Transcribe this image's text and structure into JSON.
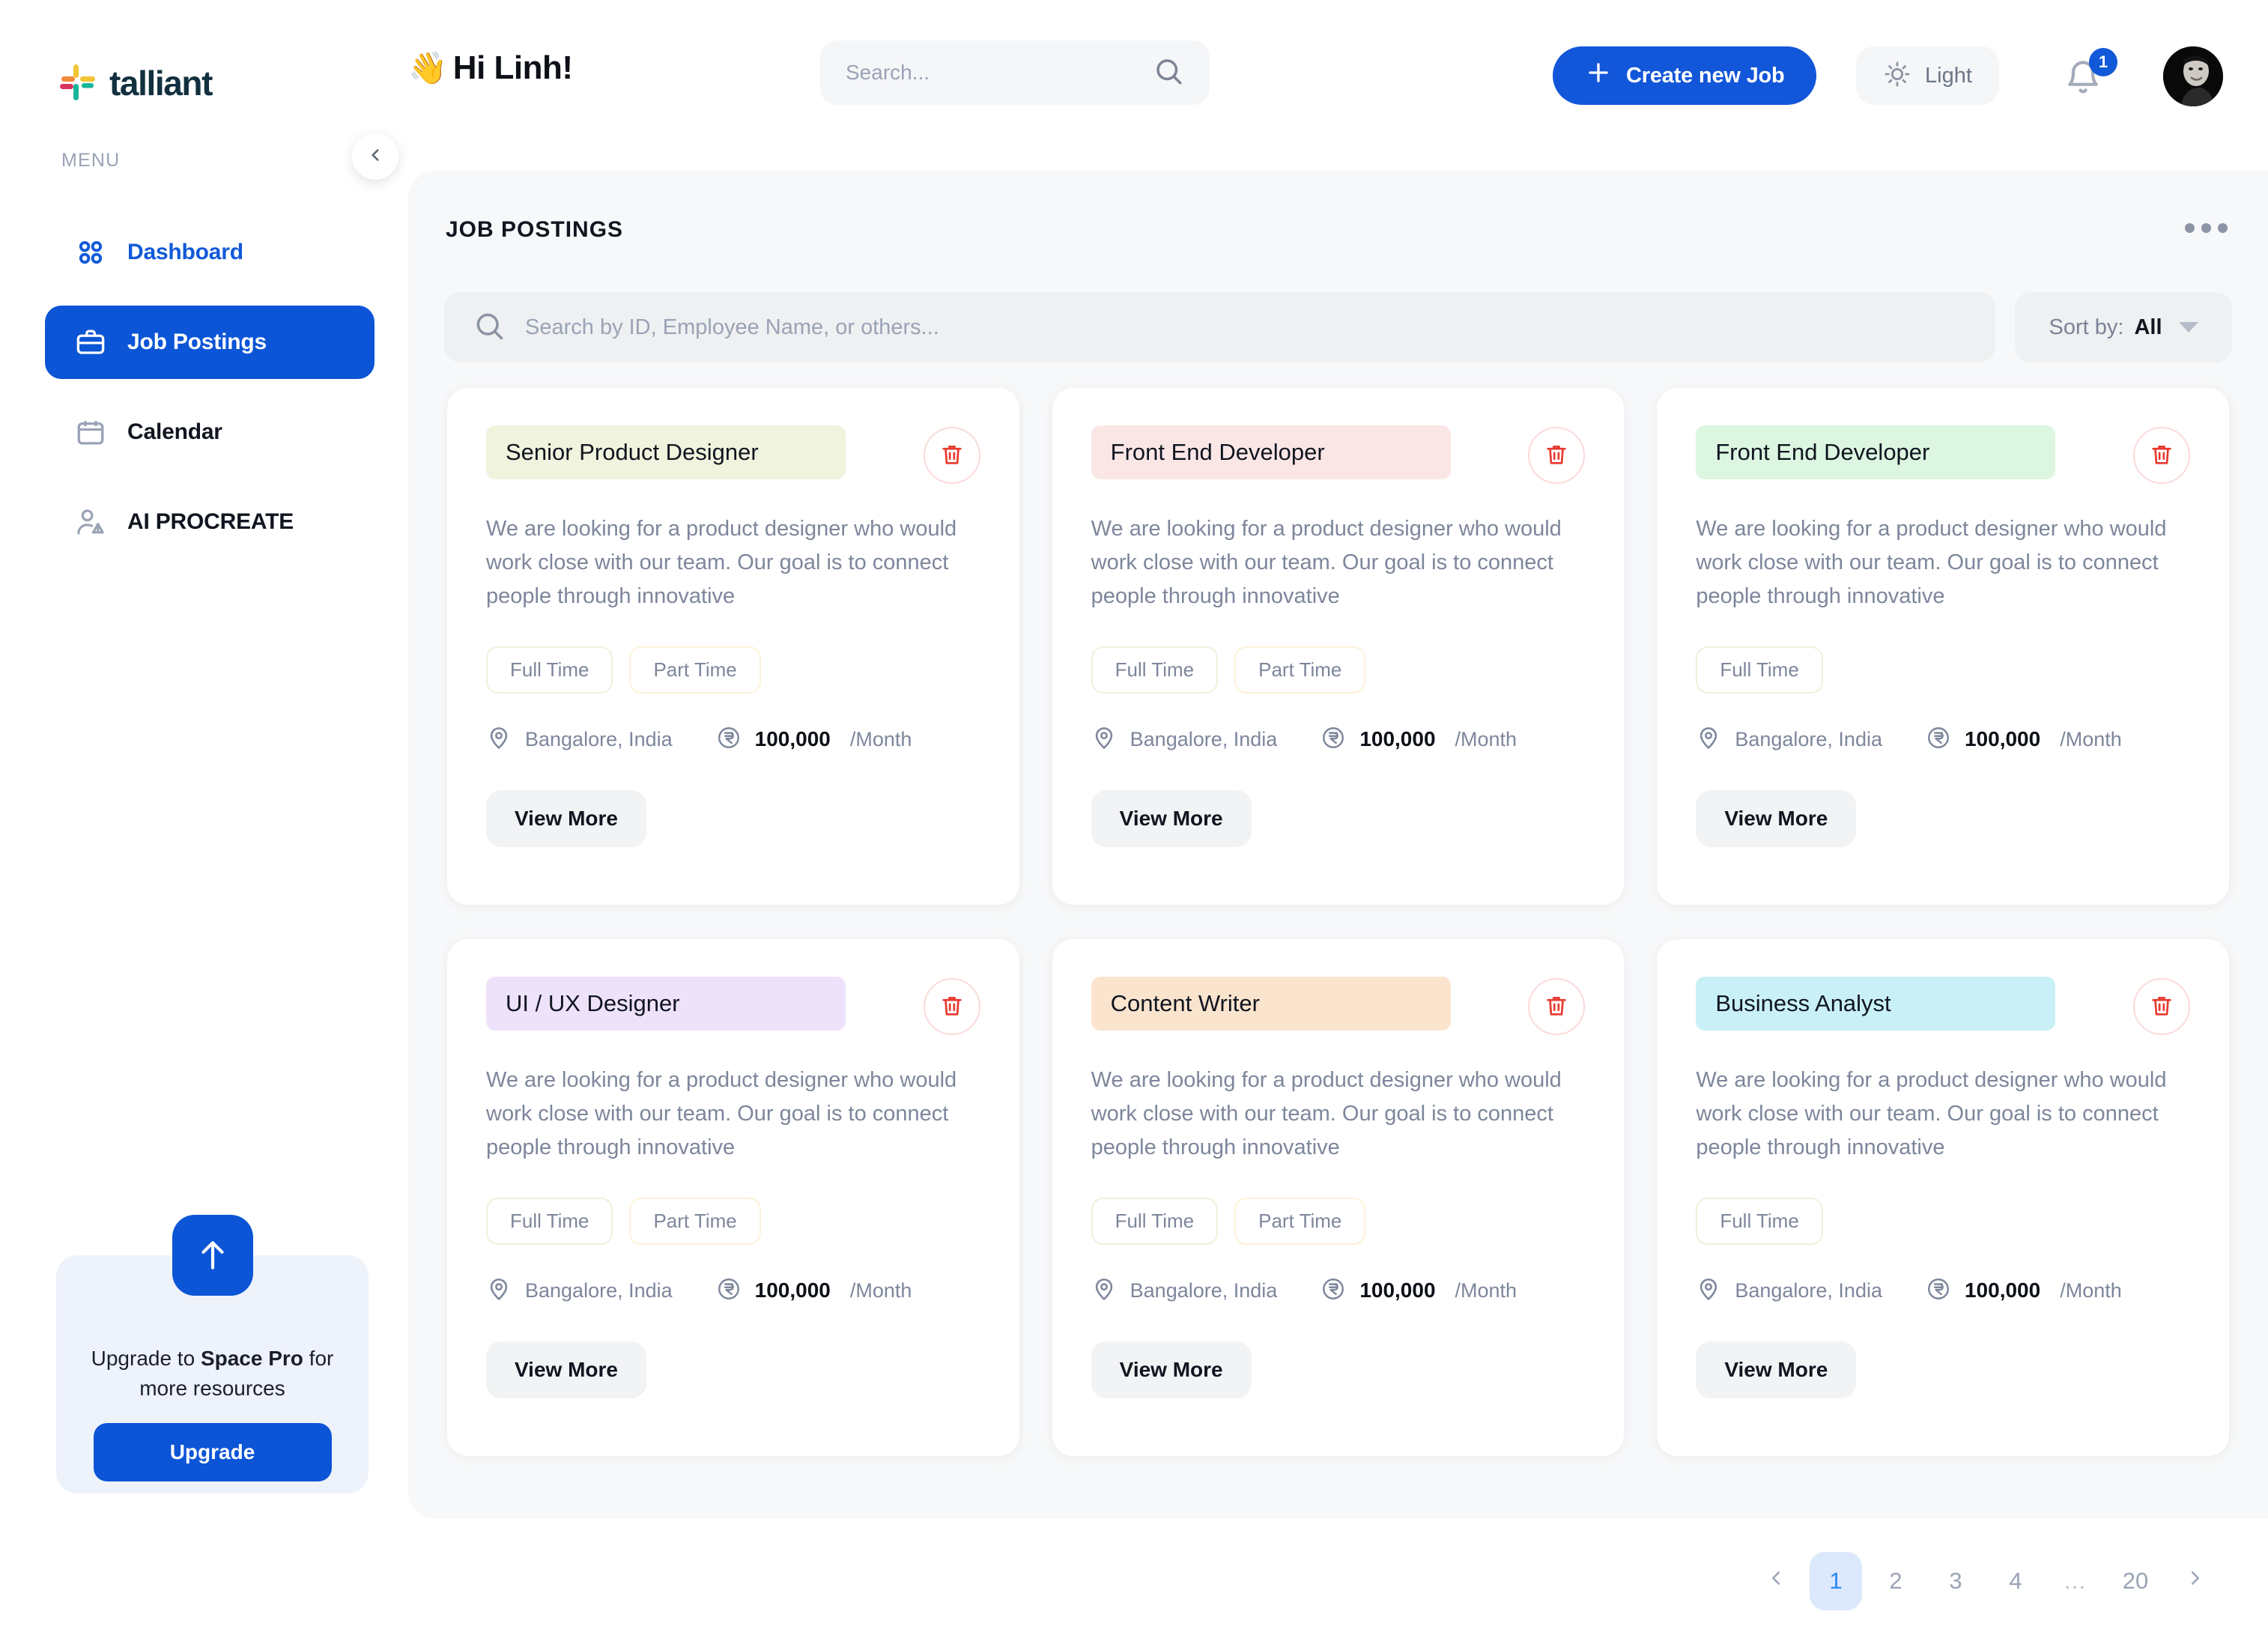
{
  "brand": {
    "name": "talliant",
    "logo_icon": "talliant-cross-logo"
  },
  "sidebar": {
    "menu_label": "MENU",
    "collapse_icon": "chevron-left-icon",
    "items": [
      {
        "label": "Dashboard",
        "icon": "grid-dots-icon",
        "state": "highlighted"
      },
      {
        "label": "Job Postings",
        "icon": "briefcase-icon",
        "state": "active"
      },
      {
        "label": "Calendar",
        "icon": "calendar-icon",
        "state": "default"
      },
      {
        "label": "AI PROCREATE",
        "icon": "user-alert-icon",
        "state": "default"
      }
    ],
    "upgrade": {
      "icon": "arrow-up-icon",
      "text_before": "Upgrade to ",
      "text_bold": "Space Pro",
      "text_after": " for more resources",
      "button_label": "Upgrade"
    }
  },
  "topbar": {
    "greeting_emoji": "👋",
    "greeting": "Hi Linh!",
    "search": {
      "value": "",
      "placeholder": "Search...",
      "icon": "search-icon"
    },
    "create_button": {
      "label": "Create new Job",
      "icon": "plus-icon"
    },
    "theme_toggle": {
      "label": "Light",
      "icon": "sun-icon"
    },
    "notifications": {
      "count": "1",
      "icon": "bell-icon"
    },
    "avatar": {
      "icon": "user-avatar"
    }
  },
  "panel": {
    "title": "JOB POSTINGS",
    "more_icon": "ellipsis-icon",
    "search": {
      "value": "",
      "placeholder": "Search by ID, Employee Name, or others...",
      "icon": "search-icon"
    },
    "sort": {
      "label": "Sort by:",
      "value": "All",
      "icon": "chevron-down-icon"
    }
  },
  "colors": {
    "brand_blue": "#0b55d6",
    "accent_blue": "#1159d8",
    "panel_bg": "#f7f8f9",
    "delete_red": "#e8392e",
    "pager_active_bg": "#dce8fb",
    "pager_active_text": "#2d88f3"
  },
  "cards": [
    {
      "title": "Senior Product Designer",
      "title_bg": "#f0f3dd",
      "description": "We are looking for a product designer who would work close with our team. Our goal is to connect people through innovative",
      "tags": [
        {
          "label": "Full Time",
          "tone": "green"
        },
        {
          "label": "Part Time",
          "tone": "yellow"
        }
      ],
      "location": "Bangalore, India",
      "salary": "100,000",
      "salary_period": "/Month",
      "currency_icon": "rupee-icon",
      "location_icon": "map-pin-icon",
      "delete_icon": "trash-icon",
      "action_label": "View More"
    },
    {
      "title": "Front End Developer",
      "title_bg": "#fbe6e6",
      "description": "We are looking for a product designer who would work close with our team. Our goal is to connect people through innovative",
      "tags": [
        {
          "label": "Full Time",
          "tone": "green"
        },
        {
          "label": "Part Time",
          "tone": "yellow"
        }
      ],
      "location": "Bangalore, India",
      "salary": "100,000",
      "salary_period": "/Month",
      "currency_icon": "rupee-icon",
      "location_icon": "map-pin-icon",
      "delete_icon": "trash-icon",
      "action_label": "View More"
    },
    {
      "title": "Front End Developer",
      "title_bg": "#dcf6e1",
      "description": "We are looking for a product designer who would work close with our team. Our goal is to connect people through innovative",
      "tags": [
        {
          "label": "Full Time",
          "tone": "green"
        }
      ],
      "location": "Bangalore, India",
      "salary": "100,000",
      "salary_period": "/Month",
      "currency_icon": "rupee-icon",
      "location_icon": "map-pin-icon",
      "delete_icon": "trash-icon",
      "action_label": "View More"
    },
    {
      "title": "UI / UX Designer",
      "title_bg": "#eee2fb",
      "description": "We are looking for a product designer who would work close with our team. Our goal is to connect people through innovative",
      "tags": [
        {
          "label": "Full Time",
          "tone": "green"
        },
        {
          "label": "Part Time",
          "tone": "yellow"
        }
      ],
      "location": "Bangalore, India",
      "salary": "100,000",
      "salary_period": "/Month",
      "currency_icon": "rupee-icon",
      "location_icon": "map-pin-icon",
      "delete_icon": "trash-icon",
      "action_label": "View More"
    },
    {
      "title": "Content Writer",
      "title_bg": "#fbe4ce",
      "description": "We are looking for a product designer who would work close with our team. Our goal is to connect people through innovative",
      "tags": [
        {
          "label": "Full Time",
          "tone": "green"
        },
        {
          "label": "Part Time",
          "tone": "yellow"
        }
      ],
      "location": "Bangalore, India",
      "salary": "100,000",
      "salary_period": "/Month",
      "currency_icon": "rupee-icon",
      "location_icon": "map-pin-icon",
      "delete_icon": "trash-icon",
      "action_label": "View More"
    },
    {
      "title": "Business Analyst",
      "title_bg": "#c9f0f7",
      "description": "We are looking for a product designer who would work close with our team. Our goal is to connect people through innovative",
      "tags": [
        {
          "label": "Full Time",
          "tone": "green"
        }
      ],
      "location": "Bangalore, India",
      "salary": "100,000",
      "salary_period": "/Month",
      "currency_icon": "rupee-icon",
      "location_icon": "map-pin-icon",
      "delete_icon": "trash-icon",
      "action_label": "View More"
    }
  ],
  "pagination": {
    "prev_icon": "chevron-left-icon",
    "next_icon": "chevron-right-icon",
    "pages": [
      "1",
      "2",
      "3",
      "4",
      "…",
      "20"
    ],
    "current": "1"
  }
}
